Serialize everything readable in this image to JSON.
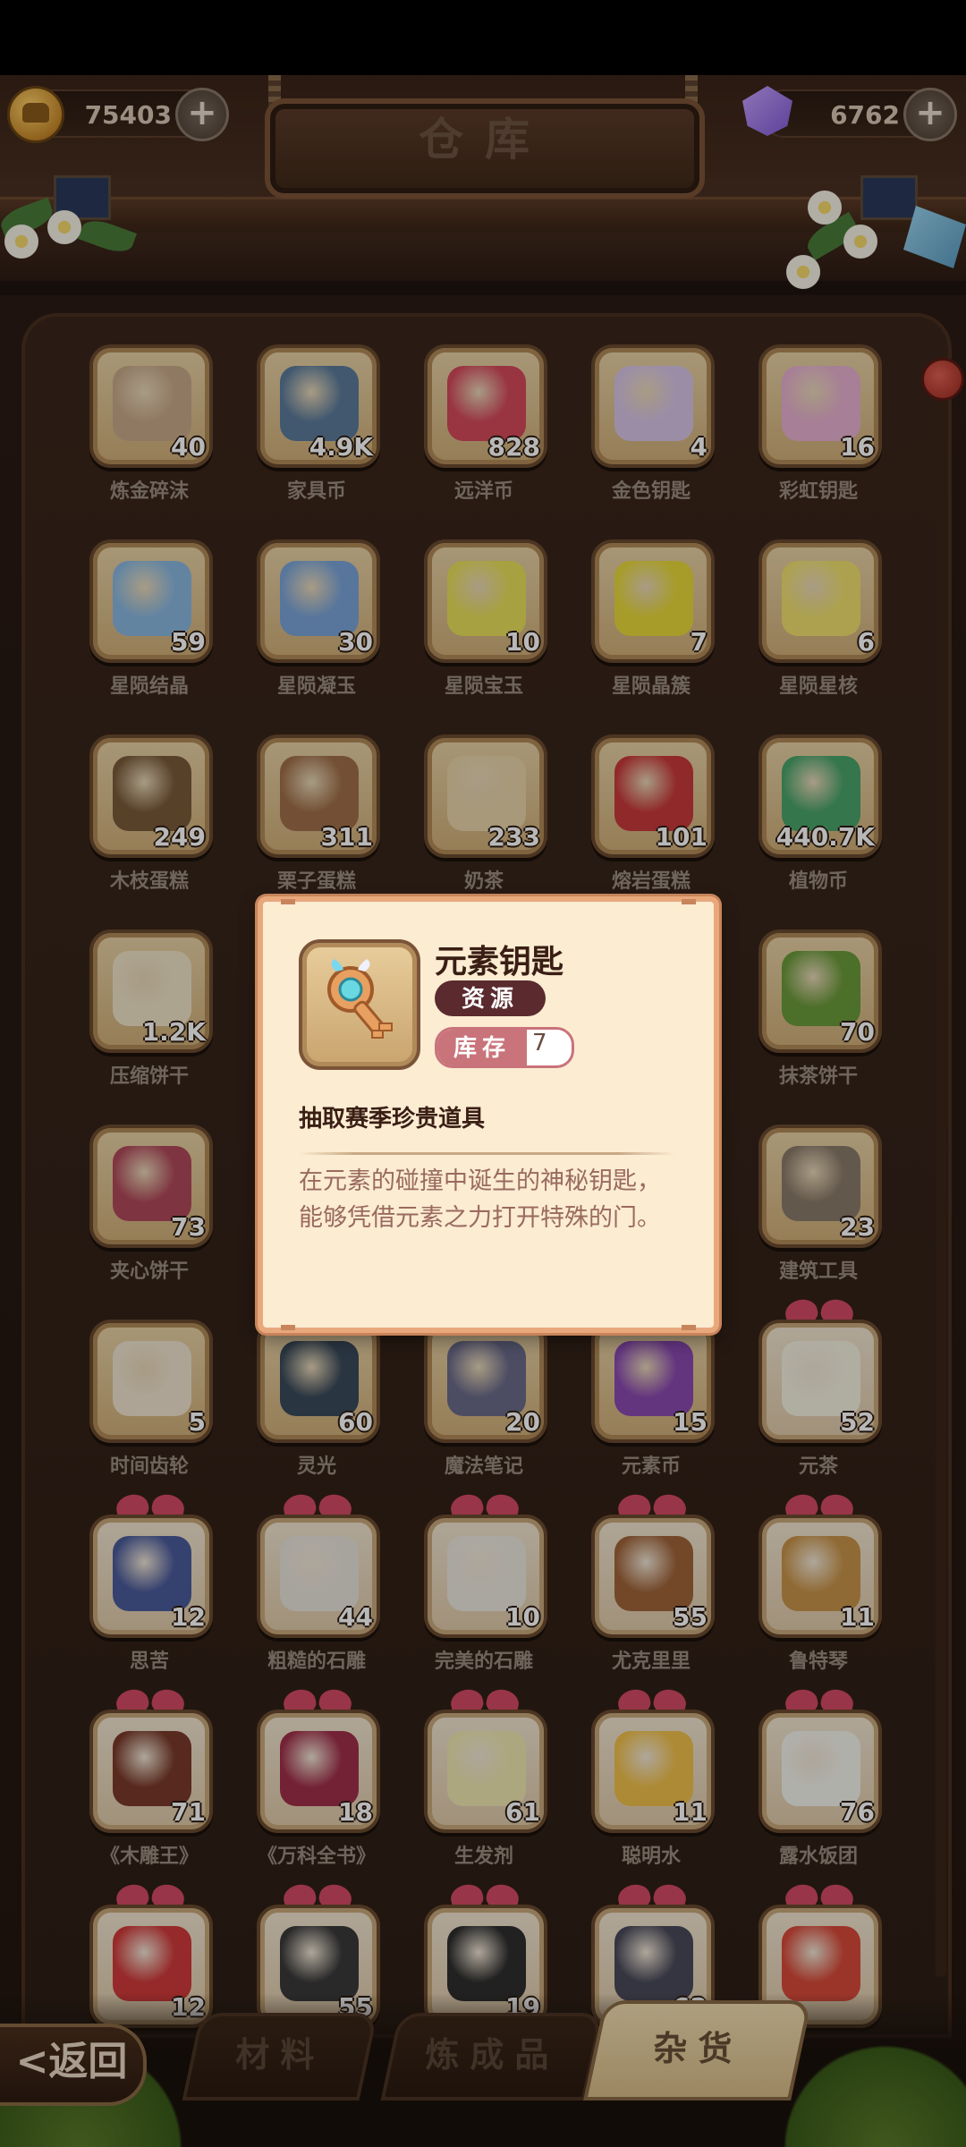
{
  "header": {
    "title": "仓库",
    "coins": "75403",
    "gems": "6762",
    "plus_label": "+"
  },
  "items": [
    {
      "name": "炼金碎沫",
      "count": "40",
      "art": "alchemy-rubble",
      "color": "#c8a88a",
      "gift": false
    },
    {
      "name": "家具币",
      "count": "4.9K",
      "art": "furniture-coin",
      "color": "#5a7a9a",
      "gift": false
    },
    {
      "name": "远洋币",
      "count": "828",
      "art": "ocean-coin",
      "color": "#d4485a",
      "gift": false
    },
    {
      "name": "金色钥匙",
      "count": "4",
      "art": "golden-key",
      "color": "#d8c4e8",
      "gift": false
    },
    {
      "name": "彩虹钥匙",
      "count": "16",
      "art": "rainbow-key",
      "color": "#e8b0d0",
      "gift": false
    },
    {
      "name": "星陨结晶",
      "count": "59",
      "art": "star-crystal",
      "color": "#8ab8e0",
      "gift": false
    },
    {
      "name": "星陨凝玉",
      "count": "30",
      "art": "star-jade",
      "color": "#7aa4d8",
      "gift": false
    },
    {
      "name": "星陨宝玉",
      "count": "10",
      "art": "star-gem",
      "color": "#e8e05a",
      "gift": false
    },
    {
      "name": "星陨晶簇",
      "count": "7",
      "art": "star-cluster",
      "color": "#e8d83a",
      "gift": false
    },
    {
      "name": "星陨星核",
      "count": "6",
      "art": "star-core",
      "color": "#f0e070",
      "gift": false
    },
    {
      "name": "木枝蛋糕",
      "count": "249",
      "art": "log-cake",
      "color": "#7a5a3a",
      "gift": false
    },
    {
      "name": "栗子蛋糕",
      "count": "311",
      "art": "chestnut-cake",
      "color": "#a0704a",
      "gift": false
    },
    {
      "name": "奶茶",
      "count": "233",
      "art": "milk-tea",
      "color": "#e8d4a8",
      "gift": false
    },
    {
      "name": "熔岩蛋糕",
      "count": "101",
      "art": "lava-cake",
      "color": "#c83a3a",
      "gift": false
    },
    {
      "name": "植物币",
      "count": "440.7K",
      "art": "plant-coin",
      "color": "#4aa46a",
      "gift": false
    },
    {
      "name": "压缩饼干",
      "count": "1.2K",
      "art": "compressed-biscuit",
      "color": "#f0e4c8",
      "gift": false
    },
    {
      "name": "",
      "count": "",
      "art": "hidden",
      "color": "#cfae78",
      "gift": false
    },
    {
      "name": "",
      "count": "",
      "art": "hidden",
      "color": "#cfae78",
      "gift": false
    },
    {
      "name": "",
      "count": "",
      "art": "hidden",
      "color": "#cfae78",
      "gift": false
    },
    {
      "name": "抹茶饼干",
      "count": "70",
      "art": "matcha-cookie",
      "color": "#6a9a3a",
      "gift": false
    },
    {
      "name": "夹心饼干",
      "count": "73",
      "art": "sandwich-cookie",
      "color": "#b04a5a",
      "gift": false
    },
    {
      "name": "",
      "count": "",
      "art": "hidden",
      "color": "#cfae78",
      "gift": false
    },
    {
      "name": "",
      "count": "",
      "art": "hidden",
      "color": "#cfae78",
      "gift": false
    },
    {
      "name": "",
      "count": "",
      "art": "hidden",
      "color": "#cfae78",
      "gift": false
    },
    {
      "name": "建筑工具",
      "count": "23",
      "art": "build-tools",
      "color": "#8a7a6a",
      "gift": false
    },
    {
      "name": "时间齿轮",
      "count": "5",
      "art": "time-gear",
      "color": "#f0e4d0",
      "gift": false
    },
    {
      "name": "灵光",
      "count": "60",
      "art": "inspiration",
      "color": "#3a4a5a",
      "gift": false
    },
    {
      "name": "魔法笔记",
      "count": "20",
      "art": "magic-notes",
      "color": "#6a6a8a",
      "gift": false
    },
    {
      "name": "元素币",
      "count": "15",
      "art": "element-coin",
      "color": "#8a4ab0",
      "gift": false
    },
    {
      "name": "元茶",
      "count": "52",
      "art": "yuan-tea",
      "color": "#f4f0e0",
      "gift": true
    },
    {
      "name": "思苦",
      "count": "12",
      "art": "thinking-jar",
      "color": "#4a5a9a",
      "gift": true
    },
    {
      "name": "粗糙的石雕",
      "count": "44",
      "art": "rough-sculpture",
      "color": "#e8e4dc",
      "gift": true
    },
    {
      "name": "完美的石雕",
      "count": "10",
      "art": "perfect-sculpture",
      "color": "#ece8e0",
      "gift": true
    },
    {
      "name": "尤克里里",
      "count": "55",
      "art": "ukulele",
      "color": "#a0643a",
      "gift": true
    },
    {
      "name": "鲁特琴",
      "count": "11",
      "art": "lute",
      "color": "#c8944a",
      "gift": true
    },
    {
      "name": "《木雕王》",
      "count": "71",
      "art": "woodcarving-book",
      "color": "#7a3a2a",
      "gift": true
    },
    {
      "name": "《万科全书》",
      "count": "18",
      "art": "encyclopedia",
      "color": "#a0304a",
      "gift": true
    },
    {
      "name": "生发剂",
      "count": "61",
      "art": "hair-tonic",
      "color": "#f0e8b0",
      "gift": true
    },
    {
      "name": "聪明水",
      "count": "11",
      "art": "smart-water",
      "color": "#f0c04a",
      "gift": true
    },
    {
      "name": "露水饭团",
      "count": "76",
      "art": "rice-ball",
      "color": "#f4f4ec",
      "gift": true
    },
    {
      "name": "",
      "count": "12",
      "art": "red-helmet",
      "color": "#d03a3a",
      "gift": true
    },
    {
      "name": "",
      "count": "55",
      "art": "dumbbell",
      "color": "#3a3a3a",
      "gift": true
    },
    {
      "name": "",
      "count": "19",
      "art": "dumbbells",
      "color": "#2e2e2e",
      "gift": true
    },
    {
      "name": "",
      "count": "62",
      "art": "dark-orb",
      "color": "#4a4a5a",
      "gift": true
    },
    {
      "name": "",
      "count": "",
      "art": "dragon-egg",
      "color": "#d84a3a",
      "gift": true
    }
  ],
  "popup": {
    "title": "元素钥匙",
    "category": "资源",
    "stock_label": "库存",
    "stock_value": "7",
    "subtitle": "抽取赛季珍贵道具",
    "description": "在元素的碰撞中诞生的神秘钥匙，能够凭借元素之力打开特殊的门。",
    "icon": "element-key-icon"
  },
  "tabs": {
    "back": "<返回",
    "materials": "材料",
    "alchemy": "炼成品",
    "goods": "杂货"
  },
  "colors": {
    "popup_bg": "#fbecd2",
    "popup_border": "#e8a87c",
    "category_badge": "#5a2a2e",
    "stock_badge": "#c9737a",
    "slot_bg": "#e8d2a6"
  }
}
